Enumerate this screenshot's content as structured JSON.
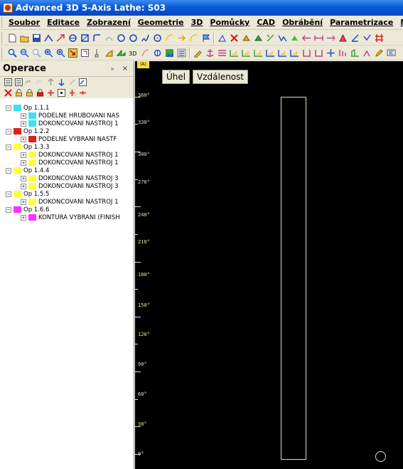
{
  "window": {
    "title": "Advanced 3D 5-Axis Lathe: S03"
  },
  "menu": [
    "Soubor",
    "Editace",
    "Zobrazení",
    "Geometrie",
    "3D",
    "Pomůcky",
    "CAD",
    "Obrábění",
    "Parametrizace",
    "Nápo"
  ],
  "operations_panel": {
    "title": "Operace",
    "controls": "&#x2095; ×",
    "tree": [
      {
        "label": "Op 1.1.1",
        "color": "#40e0f0",
        "children": [
          "PODELNE HRUBOVANI  NAS",
          "DOKONCOVANI  NASTROJ 1"
        ]
      },
      {
        "label": "Op 1.2.2",
        "color": "#e02020",
        "children": [
          "PODELNE VYBRANI  NASTF"
        ]
      },
      {
        "label": "Op 1.3.3",
        "color": "#ffff40",
        "children": [
          "DOKONCOVANI  NASTROJ 1",
          "DOKONCOVANI  NASTROJ 1"
        ]
      },
      {
        "label": "Op 1.4.4",
        "color": "#ffff40",
        "children": [
          "DOKONCOVANI  NASTROJ 3",
          "DOKONCOVANI  NASTROJ 3"
        ]
      },
      {
        "label": "Op 1.5.5",
        "color": "#ffff40",
        "children": [
          "DOKONCOVANI  NASTROJ 1"
        ]
      },
      {
        "label": "Op 1.6.6",
        "color": "#ff30ff",
        "children": [
          "KONTURA VYBRANI (FINISH"
        ]
      }
    ]
  },
  "viewport": {
    "axis_button": "(A)",
    "angle_button": "Úhel",
    "distance_button": "Vzdálenost",
    "ruler_labels": [
      "360°",
      "330°",
      "300°",
      "270°",
      "240°",
      "210°",
      "180°",
      "150°",
      "120°",
      "90°",
      "60°",
      "30°",
      "0°"
    ]
  }
}
